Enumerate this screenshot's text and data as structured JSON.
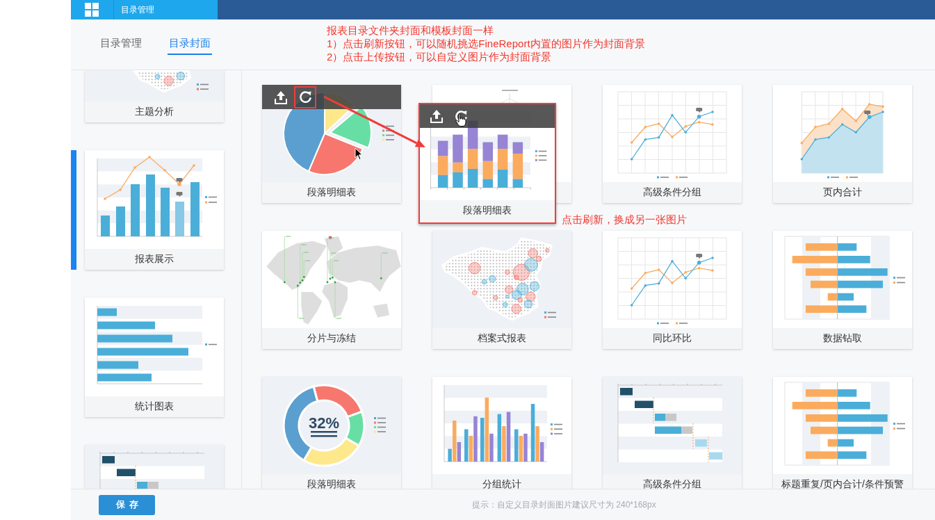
{
  "header": {
    "title": "目录管理"
  },
  "tabs": [
    {
      "label": "目录管理",
      "selected": false
    },
    {
      "label": "目录封面",
      "selected": true
    }
  ],
  "note": {
    "lines": [
      "报表目录文件夹封面和模板封面一样",
      "1）点击刷新按钮，可以随机挑选FineReport内置的图片作为封面背景",
      "2）点击上传按钮，可以自定义图片作为封面背景"
    ]
  },
  "sidebar": {
    "items": [
      {
        "label": "主题分析",
        "cover": {
          "kind": "china-map"
        },
        "selected": false
      },
      {
        "label": "报表展示",
        "cover": {
          "kind": "bar-line"
        },
        "selected": true
      },
      {
        "label": "统计图表",
        "cover": {
          "kind": "hbar"
        },
        "selected": false
      },
      {
        "cover": {
          "kind": "gantt"
        },
        "selected": false
      }
    ]
  },
  "covers": [
    {
      "label": "段落明细表",
      "cover": {
        "kind": "pie"
      },
      "hovered": true,
      "refresh_marked": true
    },
    {
      "cover": {
        "kind": "tree"
      },
      "hovered": false
    },
    {
      "label": "高级条件分组",
      "cover": {
        "kind": "line"
      },
      "hovered": false
    },
    {
      "label": "页内合计",
      "cover": {
        "kind": "area"
      },
      "hovered": false
    },
    {
      "label": "分片与冻结",
      "cover": {
        "kind": "world-map"
      },
      "hovered": false
    },
    {
      "label": "档案式报表",
      "cover": {
        "kind": "china-map"
      },
      "hovered": false
    },
    {
      "label": "同比环比",
      "cover": {
        "kind": "line"
      },
      "hovered": false
    },
    {
      "label": "数据钻取",
      "cover": {
        "kind": "butterfly"
      },
      "hovered": false
    },
    {
      "label": "段落明细表",
      "cover": {
        "kind": "donut",
        "text": "32%"
      },
      "hovered": false
    },
    {
      "label": "分组统计",
      "cover": {
        "kind": "grouped-bar"
      },
      "hovered": false
    },
    {
      "label": "高级条件分组",
      "cover": {
        "kind": "gantt"
      },
      "hovered": false
    },
    {
      "label": "标题重复/页内合计/条件预警",
      "cover": {
        "kind": "butterfly"
      },
      "hovered": false
    }
  ],
  "refreshed_card": {
    "label": "段落明细表",
    "cover": {
      "kind": "stacked-bar"
    },
    "hovered": true
  },
  "callout": {
    "text": "点击刷新，换成另一张图片"
  },
  "footer": {
    "save_button": "保存",
    "hint": "提示：自定义目录封面图片建议尺寸为 240*168px"
  }
}
